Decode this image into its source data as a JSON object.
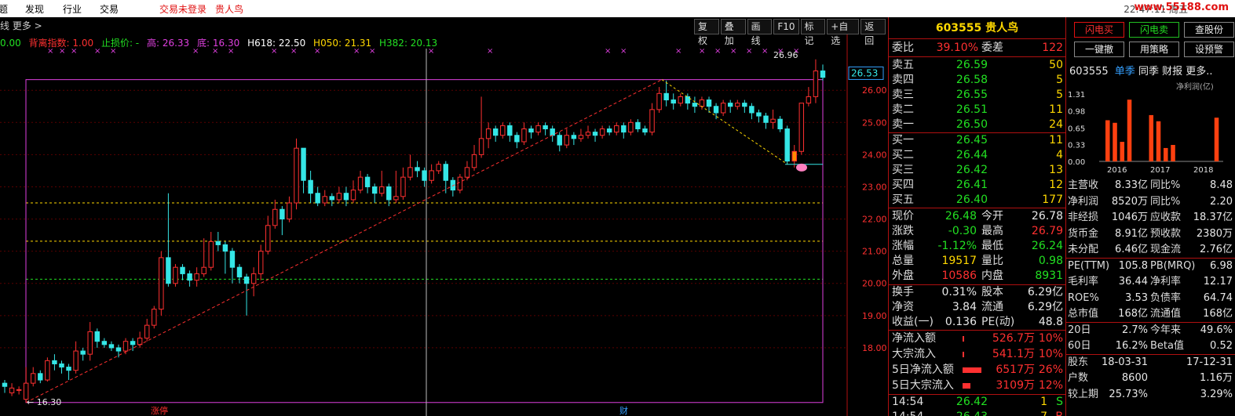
{
  "menu": {
    "items": [
      "题",
      "发现",
      "行业",
      "交易"
    ],
    "login_status": "交易未登录",
    "stock_name": "贵人鸟",
    "clock": "22:47:11 周五",
    "watermark": "www.55188.com"
  },
  "chart_header": {
    "left_text": "线 更多 >",
    "tools": [
      "复权",
      "叠加",
      "画线",
      "F10",
      "标记",
      "+自选",
      "返回"
    ],
    "indicators": [
      {
        "label": "0.00",
        "color": "#22e022"
      },
      {
        "label": "背离指数: 1.00",
        "color": "#ff3030"
      },
      {
        "label": "止损价: -",
        "color": "#22e022"
      },
      {
        "label": "高: 26.33",
        "color": "#e040e0"
      },
      {
        "label": "底: 16.30",
        "color": "#e040e0"
      },
      {
        "label": "H618: 22.50",
        "color": "#ffffff"
      },
      {
        "label": "H050: 21.31",
        "color": "#ffd800"
      },
      {
        "label": "H382: 20.13",
        "color": "#22e022"
      }
    ]
  },
  "chart_data": {
    "type": "candlestick",
    "ylim": [
      16.1,
      27.1
    ],
    "y_ticks": [
      "26.00",
      "25.00",
      "24.00",
      "23.00",
      "22.00",
      "21.00",
      "20.00",
      "19.00",
      "18.00"
    ],
    "current_price_label": "26.53",
    "high_annotation": "26.96",
    "low_annotation": "16.30",
    "bottom_markers": [
      "涨停",
      "财"
    ],
    "candles": [
      [
        16.9,
        16.8,
        17.0,
        16.6
      ],
      [
        16.6,
        16.75,
        16.9,
        16.5
      ],
      [
        16.7,
        16.7,
        16.8,
        16.55
      ],
      [
        16.4,
        16.9,
        17.4,
        16.3
      ],
      [
        16.9,
        17.2,
        17.4,
        16.8
      ],
      [
        17.2,
        17.0,
        17.3,
        16.9
      ],
      [
        17.0,
        17.6,
        17.7,
        16.95
      ],
      [
        17.6,
        17.5,
        17.8,
        17.3
      ],
      [
        17.5,
        17.4,
        17.6,
        17.2
      ],
      [
        17.4,
        17.3,
        17.5,
        17.0
      ],
      [
        17.3,
        17.9,
        18.2,
        17.2
      ],
      [
        17.9,
        17.8,
        18.0,
        17.6
      ],
      [
        17.8,
        18.5,
        18.8,
        17.6
      ],
      [
        18.5,
        18.2,
        18.6,
        18.0
      ],
      [
        18.2,
        18.1,
        18.3,
        18.0
      ],
      [
        18.1,
        18.0,
        18.2,
        17.9
      ],
      [
        18.0,
        17.9,
        18.1,
        17.7
      ],
      [
        17.9,
        18.2,
        18.3,
        17.8
      ],
      [
        18.2,
        18.1,
        18.3,
        17.9
      ],
      [
        18.1,
        18.3,
        18.5,
        18.0
      ],
      [
        18.3,
        18.7,
        18.9,
        18.2
      ],
      [
        18.7,
        19.2,
        19.3,
        18.6
      ],
      [
        19.2,
        20.8,
        21.0,
        19.0
      ],
      [
        20.8,
        20.0,
        22.8,
        19.9
      ],
      [
        20.0,
        20.5,
        20.6,
        19.9
      ],
      [
        20.5,
        20.3,
        20.6,
        20.1
      ],
      [
        20.3,
        20.1,
        20.4,
        19.9
      ],
      [
        20.1,
        20.3,
        20.5,
        19.9
      ],
      [
        20.3,
        20.5,
        21.4,
        20.2
      ],
      [
        20.5,
        21.3,
        21.6,
        20.4
      ],
      [
        21.3,
        21.2,
        21.6,
        21.0
      ],
      [
        21.2,
        21.0,
        21.3,
        20.3
      ],
      [
        21.0,
        20.5,
        21.1,
        20.0
      ],
      [
        20.5,
        20.2,
        20.6,
        20.0
      ],
      [
        20.2,
        20.0,
        20.3,
        19.0
      ],
      [
        20.0,
        20.3,
        20.5,
        19.6
      ],
      [
        20.3,
        21.0,
        21.2,
        20.1
      ],
      [
        21.0,
        21.8,
        22.1,
        20.9
      ],
      [
        21.8,
        22.3,
        22.6,
        21.7
      ],
      [
        22.3,
        22.0,
        22.4,
        21.5
      ],
      [
        22.0,
        22.5,
        22.7,
        21.9
      ],
      [
        22.5,
        24.2,
        24.5,
        22.3
      ],
      [
        24.2,
        23.2,
        24.1,
        22.8
      ],
      [
        23.2,
        22.8,
        23.5,
        22.5
      ],
      [
        22.8,
        22.5,
        23.0,
        22.4
      ],
      [
        22.5,
        22.7,
        22.9,
        22.4
      ],
      [
        22.7,
        22.6,
        22.8,
        22.4
      ],
      [
        22.6,
        22.8,
        23.0,
        22.5
      ],
      [
        22.8,
        22.6,
        23.0,
        22.4
      ],
      [
        22.6,
        22.9,
        23.2,
        22.5
      ],
      [
        22.9,
        23.3,
        23.5,
        22.8
      ],
      [
        23.3,
        23.0,
        23.4,
        22.8
      ],
      [
        23.0,
        22.8,
        23.1,
        22.5
      ],
      [
        22.8,
        23.0,
        23.5,
        22.7
      ],
      [
        23.0,
        22.6,
        23.1,
        22.4
      ],
      [
        22.6,
        22.7,
        23.5,
        22.5
      ],
      [
        22.7,
        23.3,
        23.6,
        22.6
      ],
      [
        23.3,
        23.6,
        24.0,
        23.2
      ],
      [
        23.6,
        23.5,
        23.8,
        23.3
      ],
      [
        23.5,
        23.2,
        23.6,
        23.0
      ],
      [
        23.2,
        23.5,
        23.7,
        23.1
      ],
      [
        23.5,
        23.7,
        23.8,
        23.4
      ],
      [
        23.7,
        23.2,
        23.8,
        22.8
      ],
      [
        23.2,
        22.9,
        23.3,
        22.7
      ],
      [
        22.9,
        23.3,
        23.4,
        22.8
      ],
      [
        23.3,
        23.6,
        23.8,
        23.2
      ],
      [
        23.6,
        24.0,
        24.3,
        23.5
      ],
      [
        24.0,
        24.5,
        25.8,
        23.9
      ],
      [
        24.5,
        24.8,
        25.0,
        24.2
      ],
      [
        24.8,
        24.6,
        24.9,
        24.4
      ],
      [
        24.6,
        24.9,
        25.0,
        24.5
      ],
      [
        24.9,
        24.6,
        25.0,
        24.4
      ],
      [
        24.6,
        24.4,
        24.7,
        24.2
      ],
      [
        24.4,
        24.8,
        25.0,
        24.3
      ],
      [
        24.8,
        24.7,
        24.9,
        24.5
      ],
      [
        24.7,
        24.9,
        25.0,
        24.6
      ],
      [
        24.9,
        24.8,
        25.0,
        24.6
      ],
      [
        24.8,
        24.6,
        24.9,
        24.4
      ],
      [
        24.6,
        24.3,
        24.7,
        24.1
      ],
      [
        24.3,
        24.6,
        24.8,
        24.2
      ],
      [
        24.6,
        24.5,
        24.7,
        24.3
      ],
      [
        24.5,
        24.6,
        24.8,
        24.4
      ],
      [
        24.6,
        24.7,
        24.9,
        24.5
      ],
      [
        24.7,
        24.6,
        24.8,
        24.4
      ],
      [
        24.6,
        24.8,
        24.9,
        24.5
      ],
      [
        24.8,
        24.7,
        24.9,
        24.6
      ],
      [
        24.7,
        24.9,
        25.0,
        24.6
      ],
      [
        24.9,
        24.7,
        25.0,
        24.5
      ],
      [
        24.7,
        25.0,
        25.1,
        24.6
      ],
      [
        25.0,
        24.8,
        25.1,
        24.7
      ],
      [
        24.8,
        24.7,
        24.9,
        24.6
      ],
      [
        24.7,
        25.4,
        25.6,
        24.6
      ],
      [
        25.4,
        25.9,
        26.1,
        25.3
      ],
      [
        25.9,
        25.7,
        26.3,
        25.5
      ],
      [
        25.7,
        25.6,
        25.9,
        25.4
      ],
      [
        25.6,
        25.8,
        25.9,
        25.5
      ],
      [
        25.8,
        25.6,
        25.9,
        25.4
      ],
      [
        25.6,
        25.5,
        25.8,
        25.3
      ],
      [
        25.5,
        25.7,
        25.8,
        25.4
      ],
      [
        25.7,
        25.5,
        25.8,
        25.3
      ],
      [
        25.5,
        25.3,
        25.6,
        25.1
      ],
      [
        25.3,
        25.6,
        25.7,
        25.2
      ],
      [
        25.6,
        25.5,
        25.7,
        25.3
      ],
      [
        25.5,
        25.6,
        25.7,
        25.4
      ],
      [
        25.6,
        25.5,
        25.7,
        25.3
      ],
      [
        25.5,
        25.3,
        25.6,
        25.1
      ],
      [
        25.3,
        25.2,
        25.4,
        25.0
      ],
      [
        25.2,
        25.0,
        25.3,
        24.8
      ],
      [
        25.0,
        25.1,
        25.4,
        24.8
      ],
      [
        25.1,
        24.8,
        25.2,
        24.7
      ],
      [
        24.8,
        23.8,
        24.9,
        23.7
      ],
      [
        23.8,
        24.1,
        24.3,
        23.6
      ],
      [
        24.1,
        25.6,
        25.6,
        24.0
      ],
      [
        25.6,
        25.8,
        26.1,
        25.5
      ],
      [
        25.8,
        26.6,
        26.96,
        25.6
      ],
      [
        26.6,
        26.4,
        26.8,
        26.3
      ]
    ]
  },
  "quote": {
    "code": "603555",
    "name": "贵人鸟",
    "weibi_label": "委比",
    "weibi": "39.10%",
    "weicha_label": "委差",
    "weicha": "122",
    "asks": [
      {
        "label": "卖五",
        "price": "26.59",
        "vol": "50"
      },
      {
        "label": "卖四",
        "price": "26.58",
        "vol": "5"
      },
      {
        "label": "卖三",
        "price": "26.55",
        "vol": "5"
      },
      {
        "label": "卖二",
        "price": "26.51",
        "vol": "11"
      },
      {
        "label": "卖一",
        "price": "26.50",
        "vol": "24"
      }
    ],
    "bids": [
      {
        "label": "买一",
        "price": "26.45",
        "vol": "11"
      },
      {
        "label": "买二",
        "price": "26.44",
        "vol": "4"
      },
      {
        "label": "买三",
        "price": "26.42",
        "vol": "13"
      },
      {
        "label": "买四",
        "price": "26.41",
        "vol": "12"
      },
      {
        "label": "买五",
        "price": "26.40",
        "vol": "177"
      }
    ],
    "stats": [
      {
        "l1": "现价",
        "v1": "26.48",
        "c1": "green",
        "l2": "今开",
        "v2": "26.78",
        "c2": "white"
      },
      {
        "l1": "涨跌",
        "v1": "-0.30",
        "c1": "green",
        "l2": "最高",
        "v2": "26.79",
        "c2": "red"
      },
      {
        "l1": "涨幅",
        "v1": "-1.12%",
        "c1": "green",
        "l2": "最低",
        "v2": "26.24",
        "c2": "green"
      },
      {
        "l1": "总量",
        "v1": "19517",
        "c1": "yellow",
        "l2": "量比",
        "v2": "0.98",
        "c2": "green"
      },
      {
        "l1": "外盘",
        "v1": "10586",
        "c1": "red",
        "l2": "内盘",
        "v2": "8931",
        "c2": "green"
      }
    ],
    "fundamentals": [
      {
        "l1": "换手",
        "v1": "0.31%",
        "l2": "股本",
        "v2": "6.29亿"
      },
      {
        "l1": "净资",
        "v1": "3.84",
        "l2": "流通",
        "v2": "6.29亿"
      },
      {
        "l1": "收益(一)",
        "v1": "0.136",
        "l2": "PE(动)",
        "v2": "48.8"
      }
    ],
    "flows": [
      {
        "label": "净流入额",
        "value": "526.7万",
        "pct": "10%"
      },
      {
        "label": "大宗流入",
        "value": "541.1万",
        "pct": "10%"
      },
      {
        "label": "5日净流入额",
        "value": "6517万",
        "pct": "26%"
      },
      {
        "label": "5日大宗流入",
        "value": "3109万",
        "pct": "12%"
      }
    ],
    "ticks": [
      {
        "time": "14:54",
        "price": "26.42",
        "vol": "1",
        "side": "S"
      },
      {
        "time": "14:54",
        "price": "26.43",
        "vol": "7",
        "side": "B"
      }
    ]
  },
  "side": {
    "buttons": [
      "闪电买",
      "闪电卖",
      "查股份",
      "一键撤",
      "用策略",
      "设预警"
    ],
    "code": "603555",
    "tabs": [
      "单季",
      "同季",
      "财报",
      "更多.."
    ],
    "profit_label": "净利润(亿)",
    "profit_chart": {
      "y_ticks": [
        "1.31",
        "0.98",
        "0.65",
        "0.33",
        "0.00"
      ],
      "x_ticks": [
        "2016",
        "2017",
        "2018"
      ],
      "values": [
        0.8,
        0.75,
        0.38,
        1.2,
        0.0,
        0.0,
        0.9,
        0.78,
        0.26,
        0.32,
        0.0,
        0.0,
        0.0,
        0.0,
        0.0,
        0.85
      ]
    },
    "rows": [
      {
        "l1": "主营收",
        "v1": "8.33亿",
        "l2": "同比%",
        "v2": "8.48"
      },
      {
        "l1": "净利润",
        "v1": "8520万",
        "l2": "同比%",
        "v2": "2.20"
      },
      {
        "l1": "非经损",
        "v1": "1046万",
        "l2": "应收款",
        "v2": "18.37亿"
      },
      {
        "l1": "货币金",
        "v1": "8.91亿",
        "l2": "预收款",
        "v2": "2380万"
      },
      {
        "l1": "未分配",
        "v1": "6.46亿",
        "l2": "现金流",
        "v2": "2.76亿"
      },
      {
        "l1": "PE(TTM)",
        "v1": "105.8",
        "l2": "PB(MRQ)",
        "v2": "6.98"
      },
      {
        "l1": "毛利率",
        "v1": "36.44",
        "l2": "净利率",
        "v2": "12.17"
      },
      {
        "l1": "ROE%",
        "v1": "3.53",
        "l2": "负债率",
        "v2": "64.74"
      },
      {
        "l1": "总市值",
        "v1": "168亿",
        "l2": "流通值",
        "v2": "168亿"
      },
      {
        "l1": "20日",
        "v1": "2.7%",
        "l2": "今年来",
        "v2": "49.6%"
      },
      {
        "l1": "60日",
        "v1": "16.2%",
        "l2": "Beta值",
        "v2": "0.52"
      },
      {
        "l1": "股东",
        "v1": "18-03-31",
        "l2": "",
        "v2": "17-12-31"
      },
      {
        "l1": "户数",
        "v1": "8600",
        "l2": "",
        "v2": "1.16万"
      },
      {
        "l1": "较上期",
        "v1": "25.73%",
        "l2": "",
        "v2": "3.29%"
      }
    ]
  }
}
